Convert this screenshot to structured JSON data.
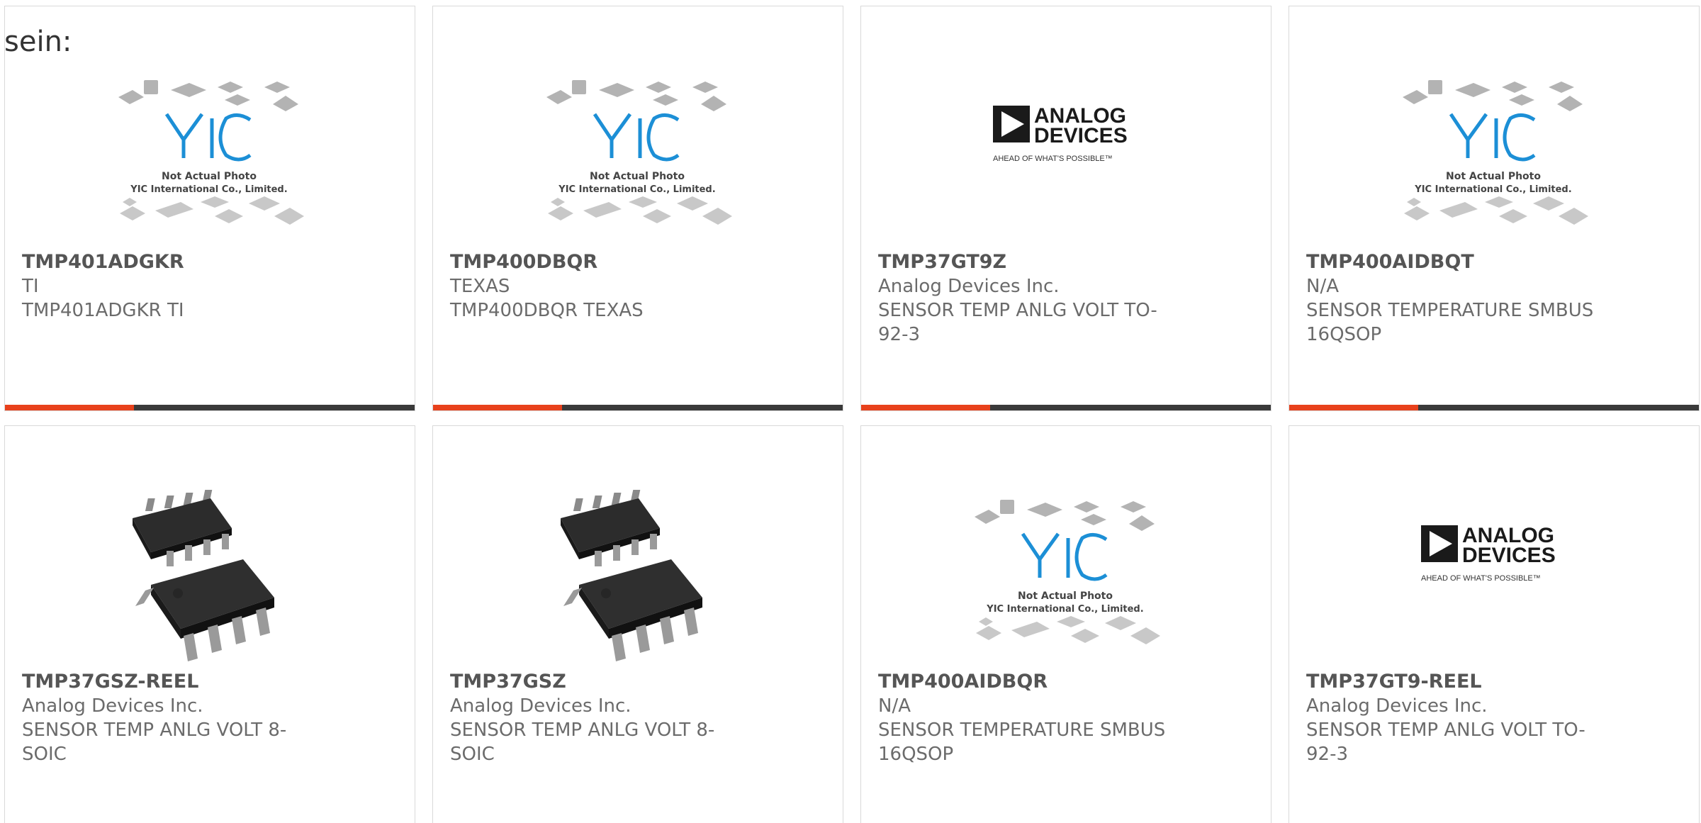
{
  "intro_text": "sein:",
  "colors": {
    "accent": "#e8411c",
    "bar": "#3a3a3a",
    "yic_blue": "#1c8fd6",
    "adi_black": "#1a1a1a"
  },
  "placeholder_yic": {
    "line1": "Not Actual Photo",
    "line2": "YIC International Co., Limited.",
    "logo": "YIC"
  },
  "placeholder_adi": {
    "line1": "ANALOG",
    "line2": "DEVICES",
    "tagline": "AHEAD OF WHAT'S POSSIBLE™"
  },
  "products": [
    {
      "part": "TMP401ADGKR",
      "maker": "TI",
      "desc": "TMP401ADGKR TI",
      "image": "yic-placeholder",
      "has_bar": true
    },
    {
      "part": "TMP400DBQR",
      "maker": "TEXAS",
      "desc": "TMP400DBQR TEXAS",
      "image": "yic-placeholder",
      "has_bar": true
    },
    {
      "part": "TMP37GT9Z",
      "maker": "Analog Devices Inc.",
      "desc": "SENSOR TEMP ANLG VOLT TO-92-3",
      "image": "adi-logo",
      "has_bar": true
    },
    {
      "part": "TMP400AIDBQT",
      "maker": "N/A",
      "desc": "SENSOR TEMPERATURE SMBUS 16QSOP",
      "image": "yic-placeholder",
      "has_bar": true
    },
    {
      "part": "TMP37GSZ-REEL",
      "maker": "Analog Devices Inc.",
      "desc": "SENSOR TEMP ANLG VOLT 8-SOIC",
      "image": "soic-chip",
      "has_bar": false
    },
    {
      "part": "TMP37GSZ",
      "maker": "Analog Devices Inc.",
      "desc": "SENSOR TEMP ANLG VOLT 8-SOIC",
      "image": "soic-chip",
      "has_bar": false
    },
    {
      "part": "TMP400AIDBQR",
      "maker": "N/A",
      "desc": "SENSOR TEMPERATURE SMBUS 16QSOP",
      "image": "yic-placeholder",
      "has_bar": false
    },
    {
      "part": "TMP37GT9-REEL",
      "maker": "Analog Devices Inc.",
      "desc": "SENSOR TEMP ANLG VOLT TO-92-3",
      "image": "adi-logo",
      "has_bar": false
    }
  ]
}
